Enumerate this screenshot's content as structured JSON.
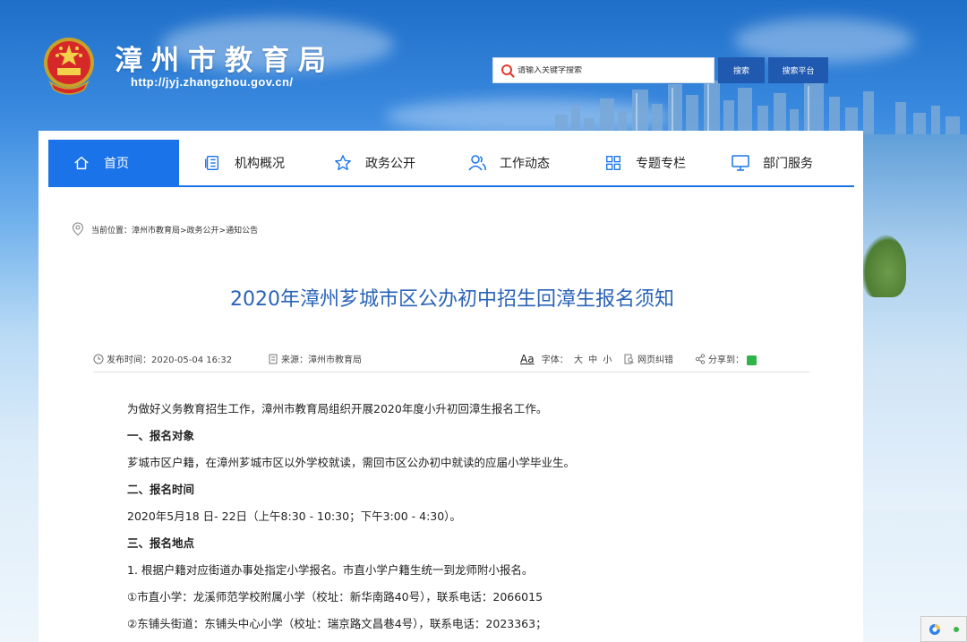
{
  "header": {
    "site_title": "漳州市教育局",
    "site_url": "http://jyj.zhangzhou.gov.cn/",
    "search_placeholder": "请输入关键字搜索",
    "search_button": "搜索",
    "platform_button": "搜索平台"
  },
  "nav": {
    "items": [
      {
        "label": "首页",
        "icon": "home-icon",
        "active": true
      },
      {
        "label": "机构概况",
        "icon": "document-list-icon",
        "active": false
      },
      {
        "label": "政务公开",
        "icon": "star-icon",
        "active": false
      },
      {
        "label": "工作动态",
        "icon": "people-icon",
        "active": false
      },
      {
        "label": "专题专栏",
        "icon": "grid-icon",
        "active": false
      },
      {
        "label": "部门服务",
        "icon": "monitor-icon",
        "active": false
      }
    ]
  },
  "breadcrumb": {
    "prefix": "当前位置：",
    "path": "漳州市教育局>政务公开>通知公告"
  },
  "article": {
    "title": "2020年漳州芗城市区公办初中招生回漳生报名须知",
    "publish_time": "发布时间：2020-05-04 16:32",
    "source": "来源：漳州市教育局",
    "font_size_label": "Aa",
    "font_label": "字体：",
    "font_large": "大",
    "font_medium": "中",
    "font_small": "小",
    "correction": "网页纠错",
    "share_label": "分享到：",
    "paragraphs": [
      {
        "text": "为做好义务教育招生工作，漳州市教育局组织开展2020年度小升初回漳生报名工作。",
        "heading": false
      },
      {
        "text": "一、报名对象",
        "heading": true
      },
      {
        "text": "芗城市区户籍，在漳州芗城市区以外学校就读，需回市区公办初中就读的应届小学毕业生。",
        "heading": false
      },
      {
        "text": "二、报名时间",
        "heading": true
      },
      {
        "text": "2020年5月18 日- 22日（上午8:30 - 10:30；下午3:00 - 4:30）。",
        "heading": false
      },
      {
        "text": "三、报名地点",
        "heading": true
      },
      {
        "text": "1. 根据户籍对应街道办事处指定小学报名。市直小学户籍生统一到龙师附小报名。",
        "heading": false
      },
      {
        "text": "①市直小学：龙溪师范学校附属小学（校址：新华南路40号），联系电话：2066015",
        "heading": false
      },
      {
        "text": "②东铺头街道：东铺头中心小学（校址：瑞京路文昌巷4号），联系电话：2023363；",
        "heading": false
      }
    ]
  },
  "colors": {
    "nav_active": "#1a73e8",
    "title": "#2a63b8",
    "button": "#1f59b0"
  }
}
